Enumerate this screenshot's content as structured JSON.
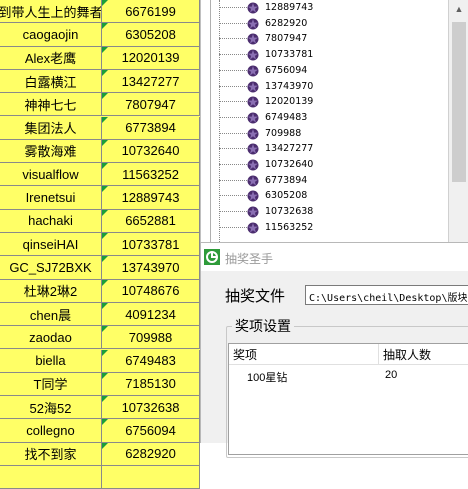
{
  "sheet_rows": [
    {
      "name": "到带人生上的舞者",
      "num": "6676199"
    },
    {
      "name": "caogaojin",
      "num": "6305208"
    },
    {
      "name": "Alex老鹰",
      "num": "12020139"
    },
    {
      "name": "白露横江",
      "num": "13427277"
    },
    {
      "name": "神神七七",
      "num": "7807947"
    },
    {
      "name": "集团法人",
      "num": "6773894"
    },
    {
      "name": "雾散海难",
      "num": "10732640"
    },
    {
      "name": "visualflow",
      "num": "11563252"
    },
    {
      "name": "Irenetsui",
      "num": "12889743"
    },
    {
      "name": "hachaki",
      "num": "6652881"
    },
    {
      "name": "qinseiHAI",
      "num": "10733781"
    },
    {
      "name": "GC_SJ72BXK",
      "num": "13743970"
    },
    {
      "name": "杜琳2琳2",
      "num": "10748676"
    },
    {
      "name": "chen晨",
      "num": "4091234"
    },
    {
      "name": "zaodao",
      "num": "709988"
    },
    {
      "name": "biella",
      "num": "6749483"
    },
    {
      "name": "T同学",
      "num": "7185130"
    },
    {
      "name": "52海52",
      "num": "10732638"
    },
    {
      "name": "collegno",
      "num": "6756094"
    },
    {
      "name": "找不到家",
      "num": "6282920"
    }
  ],
  "tree_items": [
    "12889743",
    "6282920",
    "7807947",
    "10733781",
    "6756094",
    "13743970",
    "12020139",
    "6749483",
    "709988",
    "13427277",
    "10732640",
    "6773894",
    "6305208",
    "10732638",
    "11563252"
  ],
  "dialog": {
    "title": "抽奖圣手",
    "file_label": "抽奖文件",
    "file_path": "C:\\Users\\cheil\\Desktop\\版块",
    "group_label": "奖项设置",
    "columns": [
      "奖项",
      "抽取人数"
    ],
    "rows": [
      {
        "prize": "100星钻",
        "count": "20"
      }
    ]
  },
  "colors": {
    "sheet_fill": "#ffff66",
    "tri": "#1a9e3b"
  }
}
